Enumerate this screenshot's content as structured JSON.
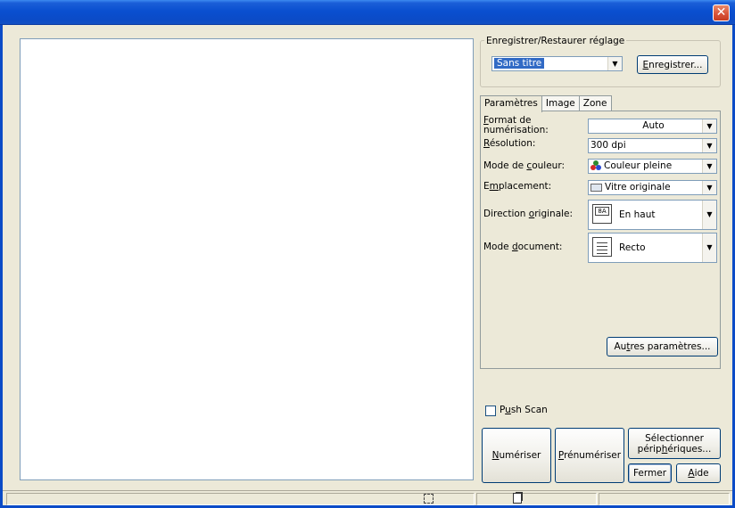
{
  "window": {
    "close_glyph": "✕"
  },
  "settings_group": {
    "label": "Enregistrer/Restaurer réglage",
    "preset_value": "Sans titre",
    "save_button_rest": "nregistrer...",
    "save_button_key": "E"
  },
  "tabs": [
    {
      "label": "Paramètres",
      "active": true
    },
    {
      "label": "Image",
      "active": false
    },
    {
      "label": "Zone",
      "active": false
    }
  ],
  "params": {
    "scan_format": {
      "key": "F",
      "label_rest": "ormat de",
      "label_line2": "numérisation:",
      "value": "Auto"
    },
    "resolution": {
      "key": "R",
      "label_rest": "ésolution:",
      "value": "300 dpi"
    },
    "color_mode": {
      "label_pre": "Mode de ",
      "key": "c",
      "label_rest": "ouleur:",
      "value": "Couleur pleine",
      "icon": "color-mode-icon"
    },
    "location": {
      "label_pre": "E",
      "key": "m",
      "label_rest": "placement:",
      "value": "Vitre originale",
      "icon": "glass-icon"
    },
    "orientation": {
      "label_pre": "Direction ",
      "key": "o",
      "label_rest": "riginale:",
      "value": "En haut",
      "icon_text": "8A"
    },
    "doc_mode": {
      "label_pre": "Mode ",
      "key": "d",
      "label_rest": "ocument:",
      "value": "Recto"
    }
  },
  "more_params_button": {
    "pre": "Au",
    "key": "t",
    "rest": "res paramètres..."
  },
  "push_scan": {
    "pre": "P",
    "key": "u",
    "rest": "sh Scan",
    "checked": false
  },
  "buttons": {
    "scan": {
      "key": "N",
      "rest": "umériser"
    },
    "prescan": {
      "key": "P",
      "rest": "rénumériser"
    },
    "select_devices": {
      "line1": "Sélectionner",
      "line2_pre": "périp",
      "line2_key": "h",
      "line2_rest": "ériques..."
    },
    "close": {
      "label": "Fermer"
    },
    "help": {
      "key": "A",
      "rest": "ide"
    }
  },
  "colors": {
    "titlebar": "#0b4bc7",
    "face": "#ece9d8",
    "selection": "#316ac5",
    "close": "#d9543a"
  }
}
